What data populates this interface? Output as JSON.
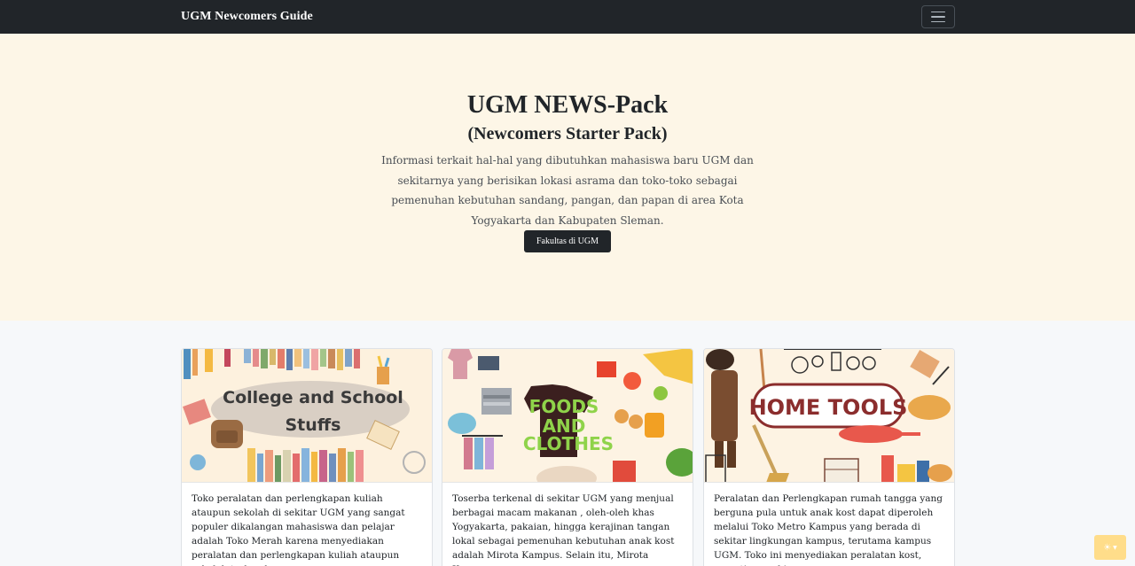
{
  "navbar": {
    "brand": "UGM Newcomers Guide",
    "toggler_icon": "hamburger-icon"
  },
  "hero": {
    "title": "UGM NEWS-Pack",
    "subtitle": "(Newcomers Starter Pack)",
    "description": "Informasi terkait hal-hal yang dibutuhkan mahasiswa baru UGM dan sekitarnya yang berisikan lokasi asrama dan toko-toko sebagai pemenuhan kebutuhan sandang, pangan, dan papan di area Kota Yogyakarta dan Kabupaten Sleman.",
    "button_label": "Fakultas di UGM"
  },
  "cards": [
    {
      "image_title_line1": "College and School",
      "image_title_line2": "Stuffs",
      "text": "Toko peralatan dan perlengkapan kuliah ataupun sekolah di sekitar UGM yang sangat populer dikalangan mahasiswa dan pelajar adalah Toko Merah karena menyediakan peralatan dan perlengkapan kuliah ataupun sekolah terlengkap."
    },
    {
      "image_title_line1": "FOODS",
      "image_title_line2": "AND",
      "image_title_line3": "CLOTHES",
      "text": "Toserba terkenal di sekitar UGM yang menjual berbagai macam makanan , oleh-oleh khas Yogyakarta, pakaian, hingga kerajinan tangan lokal sebagai pemenuhan kebutuhan anak kost adalah Mirota Kampus. Selain itu, Mirota Kampus"
    },
    {
      "image_title": "HOME TOOLS",
      "text": "Peralatan dan Perlengkapan rumah tangga yang berguna pula untuk anak kost dapat diperoleh melalui Toko Metro Kampus yang berada di sekitar lingkungan kampus, terutama kampus UGM. Toko ini menyediakan peralatan kost, seperti sapu, kipas,"
    }
  ],
  "theme_toggle": {
    "icon": "sun-icon",
    "color": "#ffdd8a"
  },
  "colors": {
    "navbar": "#212529",
    "hero_bg": "#fdf6e7",
    "page_bg": "#f6f8fa"
  }
}
